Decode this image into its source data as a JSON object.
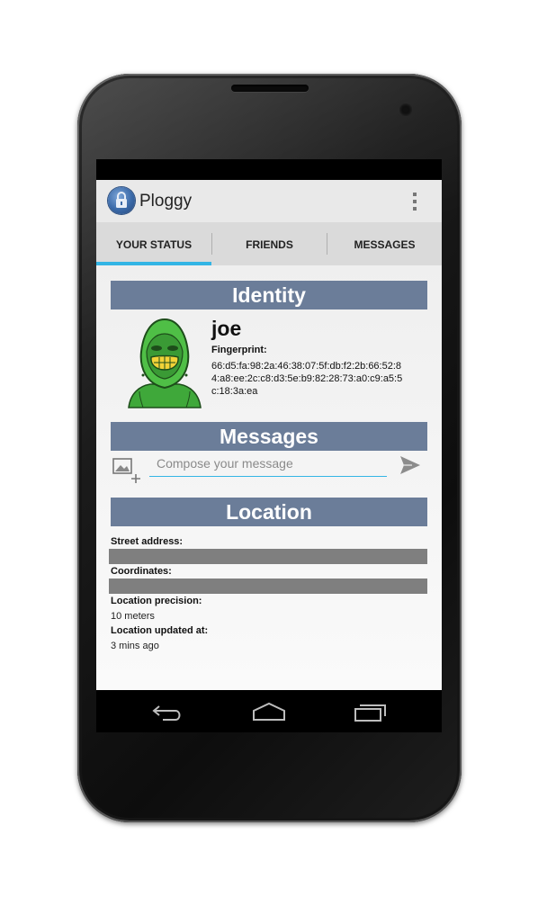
{
  "app": {
    "title": "Ploggy"
  },
  "tabs": [
    {
      "label": "YOUR STATUS",
      "selected": true
    },
    {
      "label": "FRIENDS",
      "selected": false
    },
    {
      "label": "MESSAGES",
      "selected": false
    }
  ],
  "identity": {
    "header": "Identity",
    "name": "joe",
    "fingerprint_label": "Fingerprint:",
    "fingerprint": "66:d5:fa:98:2a:46:38:07:5f:db:f2:2b:66:52:84:a8:ee:2c:c8:d3:5e:b9:82:28:73:a0:c9:a5:5c:18:3a:ea"
  },
  "messages": {
    "header": "Messages",
    "compose_placeholder": "Compose your message"
  },
  "location": {
    "header": "Location",
    "street_label": "Street address:",
    "coordinates_label": "Coordinates:",
    "precision_label": "Location precision:",
    "precision_value": "10 meters",
    "updated_label": "Location updated at:",
    "updated_value": "3 mins ago"
  },
  "icons": {
    "app": "lock-icon",
    "overflow": "overflow-menu-icon",
    "attach": "add-image-icon",
    "send": "send-icon",
    "back": "back-icon",
    "home": "home-icon",
    "recents": "recents-icon"
  },
  "colors": {
    "header_bg": "#6b7d99",
    "tab_indicator": "#33b5e5",
    "actionbar_bg": "#e9e9e9",
    "tabs_bg": "#dadada",
    "redacted_bar": "#7f7f7f"
  }
}
